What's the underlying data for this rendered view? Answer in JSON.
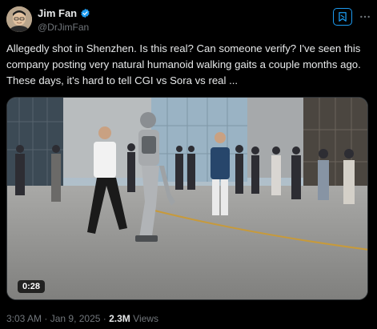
{
  "author": {
    "name": "Jim Fan",
    "handle": "@DrJimFan",
    "verified": true
  },
  "tweet": {
    "text": "Allegedly shot in Shenzhen. Is this real? Can someone verify? I've seen this company posting very natural humanoid walking gaits a couple months ago. These days, it's hard to tell CGI vs Sora vs real ..."
  },
  "media": {
    "duration": "0:28"
  },
  "meta": {
    "time": "3:03 AM",
    "separator1": "·",
    "date": "Jan 9, 2025",
    "separator2": "·",
    "views_count": "2.3M",
    "views_label": "Views"
  },
  "icons": {
    "verified": "verified-badge-icon",
    "grok": "grok-icon",
    "more": "more-options-icon"
  },
  "colors": {
    "accent": "#1d9bf0",
    "background": "#000000",
    "text": "#e7e9ea",
    "muted": "#71767b"
  }
}
